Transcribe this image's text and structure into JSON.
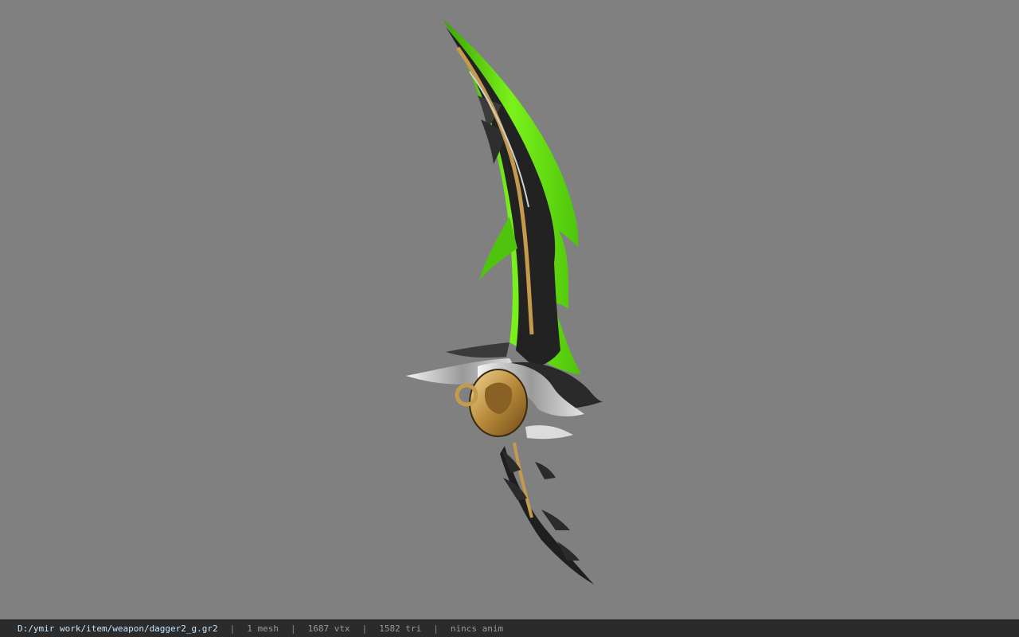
{
  "viewport": {
    "background": "#808080",
    "model_icon": "dagger-model-icon"
  },
  "status": {
    "file_path": "D:/ymir work/item/weapon/dagger2_g.gr2",
    "separator": "|",
    "mesh": "1 mesh",
    "vertices": "1687 vtx",
    "triangles": "1582 tri",
    "animation": "nincs anim"
  },
  "colors": {
    "blade_green": "#5fe10a",
    "blade_dark": "#1c1c1c",
    "gold": "#b98c3c",
    "silver": "#d8d8d8"
  }
}
